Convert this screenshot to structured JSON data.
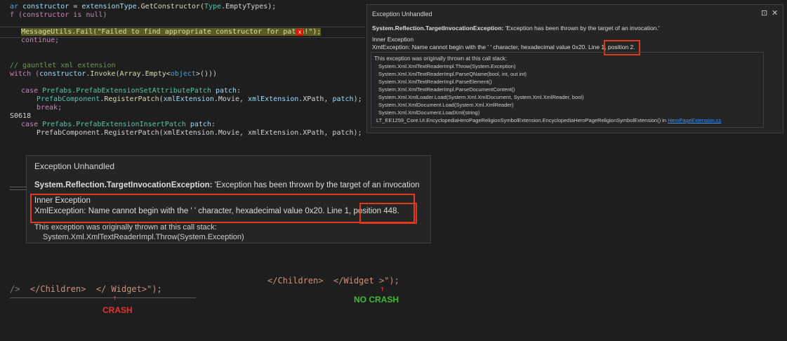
{
  "editor": {
    "lines": {
      "l1_prefix": "ar ",
      "l1_var": "constructor",
      "l1_mid": " = ",
      "l1_obj": "extensionType",
      "l1_call": ".GetConstructor(",
      "l1_type": "Type",
      "l1_end": ".EmptyTypes);",
      "l2": "f (constructor is null)",
      "l3": "MessageUtils.Fail(\"Failed to find appropriate constructor for patch!\");",
      "l4": "continue;",
      "l5": "// gauntlet xml extension",
      "l6_a": "witch (",
      "l6_b": "constructor",
      "l6_c": ".Invoke(Array.Empty<",
      "l6_d": "object",
      "l6_e": ">()))",
      "l7_a": "case ",
      "l7_b": "Prefabs.PrefabExtensionSetAttributePatch",
      "l7_c": " patch:",
      "l8_a": "PrefabComponent",
      "l8_b": ".RegisterPatch(",
      "l8_c": "xmlExtension",
      "l8_d": ".Movie, ",
      "l8_e": "xmlExtension",
      "l8_f": ".XPath, ",
      "l8_g": "patch",
      "l8_h": ");",
      "l9": "break;",
      "l10": "S0618",
      "l11_a": "case ",
      "l11_b": "Prefabs.PrefabExtensionInsertPatch",
      "l11_c": " patch:",
      "l12": "PrefabComponent.RegisterPatch(xmlExtension.Movie, xmlExtension.XPath, patch);"
    },
    "error_badge": "x"
  },
  "popup_small": {
    "title": "Exception Unhandled",
    "pin_icon": "pin-icon",
    "close_icon": "close-icon",
    "exception_type": "System.Reflection.TargetInvocationException:",
    "exception_msg": " 'Exception has been thrown by the target of an invocation.'",
    "inner_header": "Inner Exception",
    "inner_msg": "XmlException: Name cannot begin with the ' ' character, hexadecimal value 0x20. Line 1, ",
    "inner_pos": "position 2.",
    "stack_header": "This exception was originally thrown at this call stack:",
    "stack": [
      "System.Xml.XmlTextReaderImpl.Throw(System.Exception)",
      "System.Xml.XmlTextReaderImpl.ParseQName(bool, int, out int)",
      "System.Xml.XmlTextReaderImpl.ParseElement()",
      "System.Xml.XmlTextReaderImpl.ParseDocumentContent()",
      "System.Xml.XmlLoader.Load(System.Xml.XmlDocument, System.Xml.XmlReader, bool)",
      "System.Xml.XmlDocument.Load(System.Xml.XmlReader)",
      "System.Xml.XmlDocument.LoadXml(string)"
    ],
    "stack_last": "LT_EE1259_Core.UI.EncyclopediaHeroPageReligionSymbolExtension.EncyclopediaHeroPageReligionSymbolExtension() in ",
    "stack_link": "HeroPageExtension.cs"
  },
  "popup_large": {
    "title": "Exception Unhandled",
    "exception_type": "System.Reflection.TargetInvocationException:",
    "exception_msg": " 'Exception has been thrown by the target of an invocation",
    "inner_header": "Inner Exception",
    "inner_msg": "XmlException: Name cannot begin with the ' ' character, hexadecimal value 0x20. Line 1, ",
    "inner_pos": "position 448.",
    "stack_header": "This exception was originally thrown at this call stack:",
    "stack_first": "System.Xml.XmlTextReaderImpl.Throw(System.Exception)"
  },
  "comparison": {
    "crash_code_a": "/>  ",
    "crash_code_b": "</Children>",
    "crash_code_c": "  ",
    "crash_code_d": "</ Widget>",
    "crash_code_e": "\");",
    "crash_label": "CRASH",
    "nocrash_code_a": "</Children>",
    "nocrash_code_b": "  ",
    "nocrash_code_c": "</Widget >",
    "nocrash_code_d": "\");",
    "nocrash_label": "NO CRASH",
    "arrow_glyph": "↑"
  },
  "colors": {
    "highlight_box": "#e03a1e",
    "crash": "#e8322e",
    "no_crash": "#3bbf2e"
  }
}
